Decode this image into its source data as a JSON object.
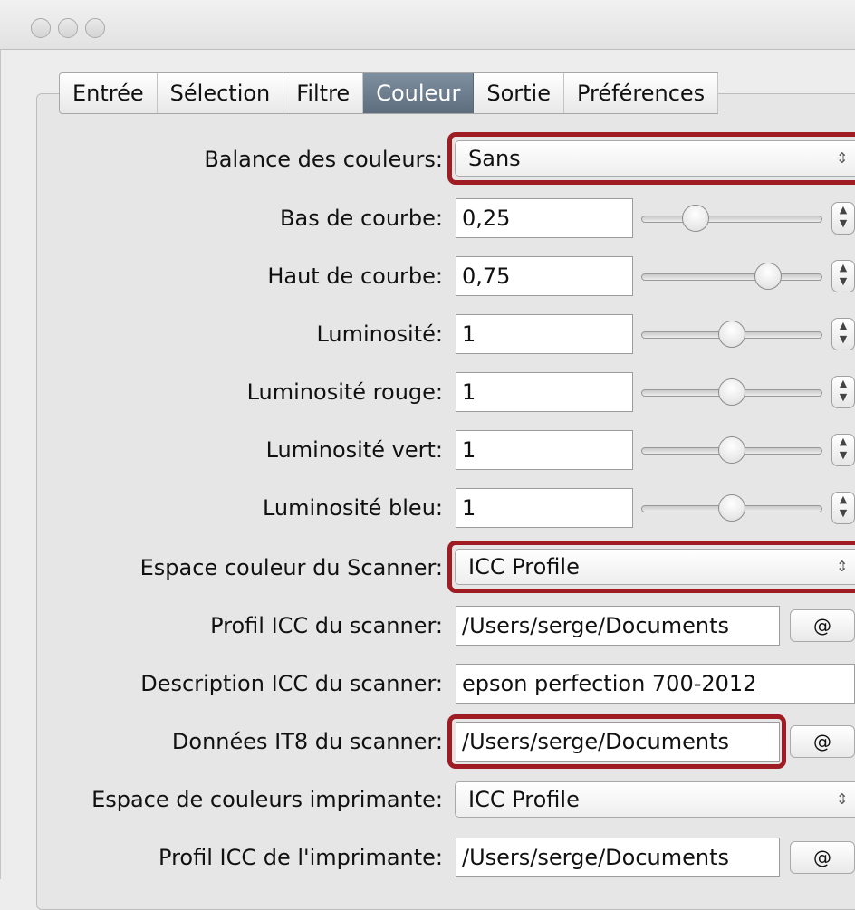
{
  "tabs": [
    "Entrée",
    "Sélection",
    "Filtre",
    "Couleur",
    "Sortie",
    "Préférences"
  ],
  "selected_tab": "Couleur",
  "highlight_color": "#9e1c22",
  "rows": {
    "color_balance": {
      "label": "Balance des couleurs:",
      "value": "Sans"
    },
    "curve_low": {
      "label": "Bas de courbe:",
      "value": "0,25",
      "slider": 0.3
    },
    "curve_high": {
      "label": "Haut de courbe:",
      "value": "0,75",
      "slider": 0.7
    },
    "brightness": {
      "label": "Luminosité:",
      "value": "1",
      "slider": 0.5
    },
    "brightness_red": {
      "label": "Luminosité rouge:",
      "value": "1",
      "slider": 0.5
    },
    "brightness_green": {
      "label": "Luminosité vert:",
      "value": "1",
      "slider": 0.5
    },
    "brightness_blue": {
      "label": "Luminosité bleu:",
      "value": "1",
      "slider": 0.5
    },
    "scanner_color_space": {
      "label": "Espace couleur du Scanner:",
      "value": "ICC Profile"
    },
    "scanner_icc_profile": {
      "label": "Profil ICC du scanner:",
      "value": "/Users/serge/Documents",
      "button": "@"
    },
    "scanner_icc_description": {
      "label": "Description ICC du scanner:",
      "value": "epson perfection 700-2012"
    },
    "scanner_it8_data": {
      "label": "Données IT8 du scanner:",
      "value": "/Users/serge/Documents",
      "button": "@"
    },
    "printer_color_space": {
      "label": "Espace de couleurs imprimante:",
      "value": "ICC Profile"
    },
    "printer_icc_profile": {
      "label": "Profil ICC de l'imprimante:",
      "value": "/Users/serge/Documents",
      "button": "@"
    }
  }
}
